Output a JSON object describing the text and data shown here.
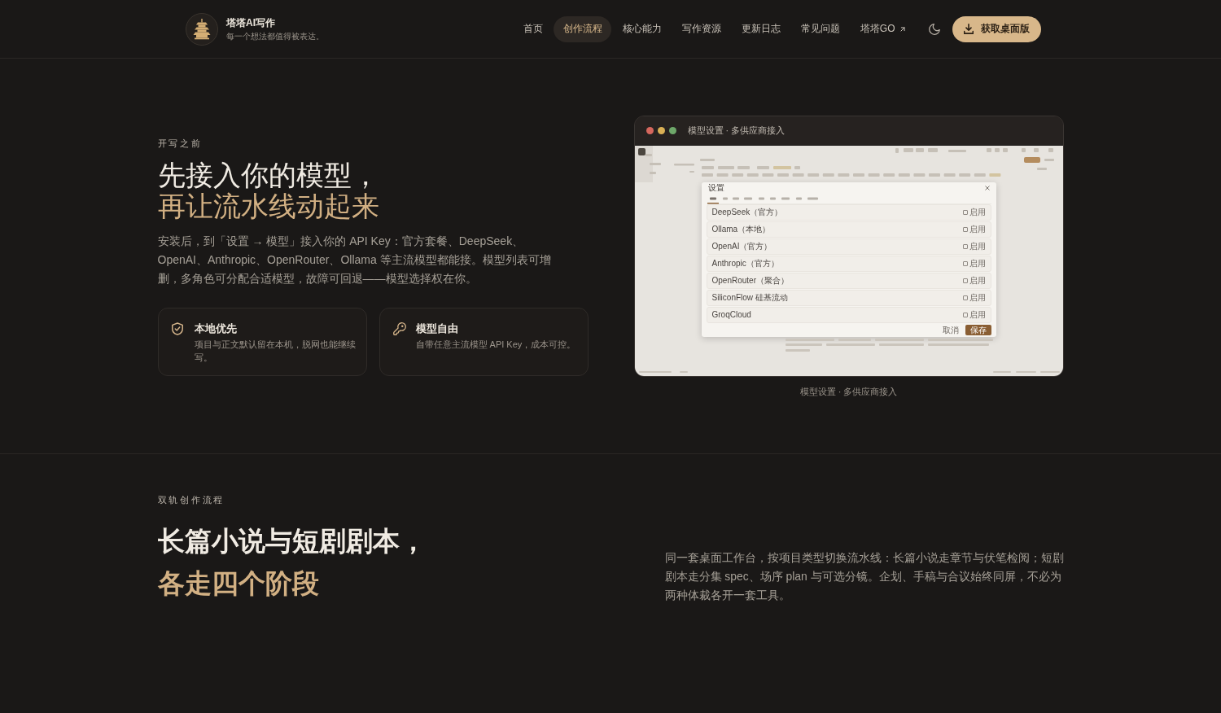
{
  "header": {
    "brand": {
      "name": "塔塔AI写作",
      "tagline": "每一个想法都值得被表达。"
    },
    "nav": [
      {
        "label": "首页",
        "selected": false,
        "external": false
      },
      {
        "label": "创作流程",
        "selected": true,
        "external": false
      },
      {
        "label": "核心能力",
        "selected": false,
        "external": false
      },
      {
        "label": "写作资源",
        "selected": false,
        "external": false
      },
      {
        "label": "更新日志",
        "selected": false,
        "external": false
      },
      {
        "label": "常见问题",
        "selected": false,
        "external": false
      },
      {
        "label": "塔塔GO",
        "selected": false,
        "external": true
      }
    ],
    "download_button": {
      "label": "获取桌面版"
    }
  },
  "setup_section": {
    "eyebrow": "开写之前",
    "title": "先接入你的模型，",
    "title_accent": "再让流水线动起来",
    "body": "安装后，到「设置 → 模型」接入你的 API Key：官方套餐、DeepSeek、OpenAI、Anthropic、OpenRouter、Ollama 等主流模型都能接。模型列表可增删，多角色可分配合适模型，故障可回退——模型选择权在你。",
    "features": [
      {
        "title": "本地优先",
        "text": "项目与正文默认留在本机，脱网也能继续写。"
      },
      {
        "title": "模型自由",
        "text": "自带任意主流模型 API Key，成本可控。"
      }
    ],
    "preview": {
      "window_title": "模型设置 · 多供应商接入",
      "dialog": {
        "title": "设置",
        "providers": [
          {
            "name": "DeepSeek（官方）",
            "checked": false,
            "toggle_label": "启用"
          },
          {
            "name": "Ollama（本地）",
            "checked": false,
            "toggle_label": "启用"
          },
          {
            "name": "OpenAI（官方）",
            "checked": false,
            "toggle_label": "启用"
          },
          {
            "name": "Anthropic（官方）",
            "checked": false,
            "toggle_label": "启用"
          },
          {
            "name": "OpenRouter（聚合）",
            "checked": false,
            "toggle_label": "启用"
          },
          {
            "name": "SiliconFlow 硅基流动",
            "checked": false,
            "toggle_label": "启用"
          },
          {
            "name": "GroqCloud",
            "checked": false,
            "toggle_label": "启用"
          }
        ],
        "cancel_button": "取消",
        "save_button": "保存"
      },
      "caption": "模型设置 · 多供应商接入"
    }
  },
  "workflow_section": {
    "eyebrow": "双轨创作流程",
    "title": "长篇小说与短剧剧本，",
    "title_accent": "各走四个阶段",
    "body": "同一套桌面工作台，按项目类型切换流水线：长篇小说走章节与伏笔检阅；短剧剧本走分集 spec、场序 plan 与可选分镜。企划、手稿与合议始终同屏，不必为两种体裁各开一套工具。"
  }
}
